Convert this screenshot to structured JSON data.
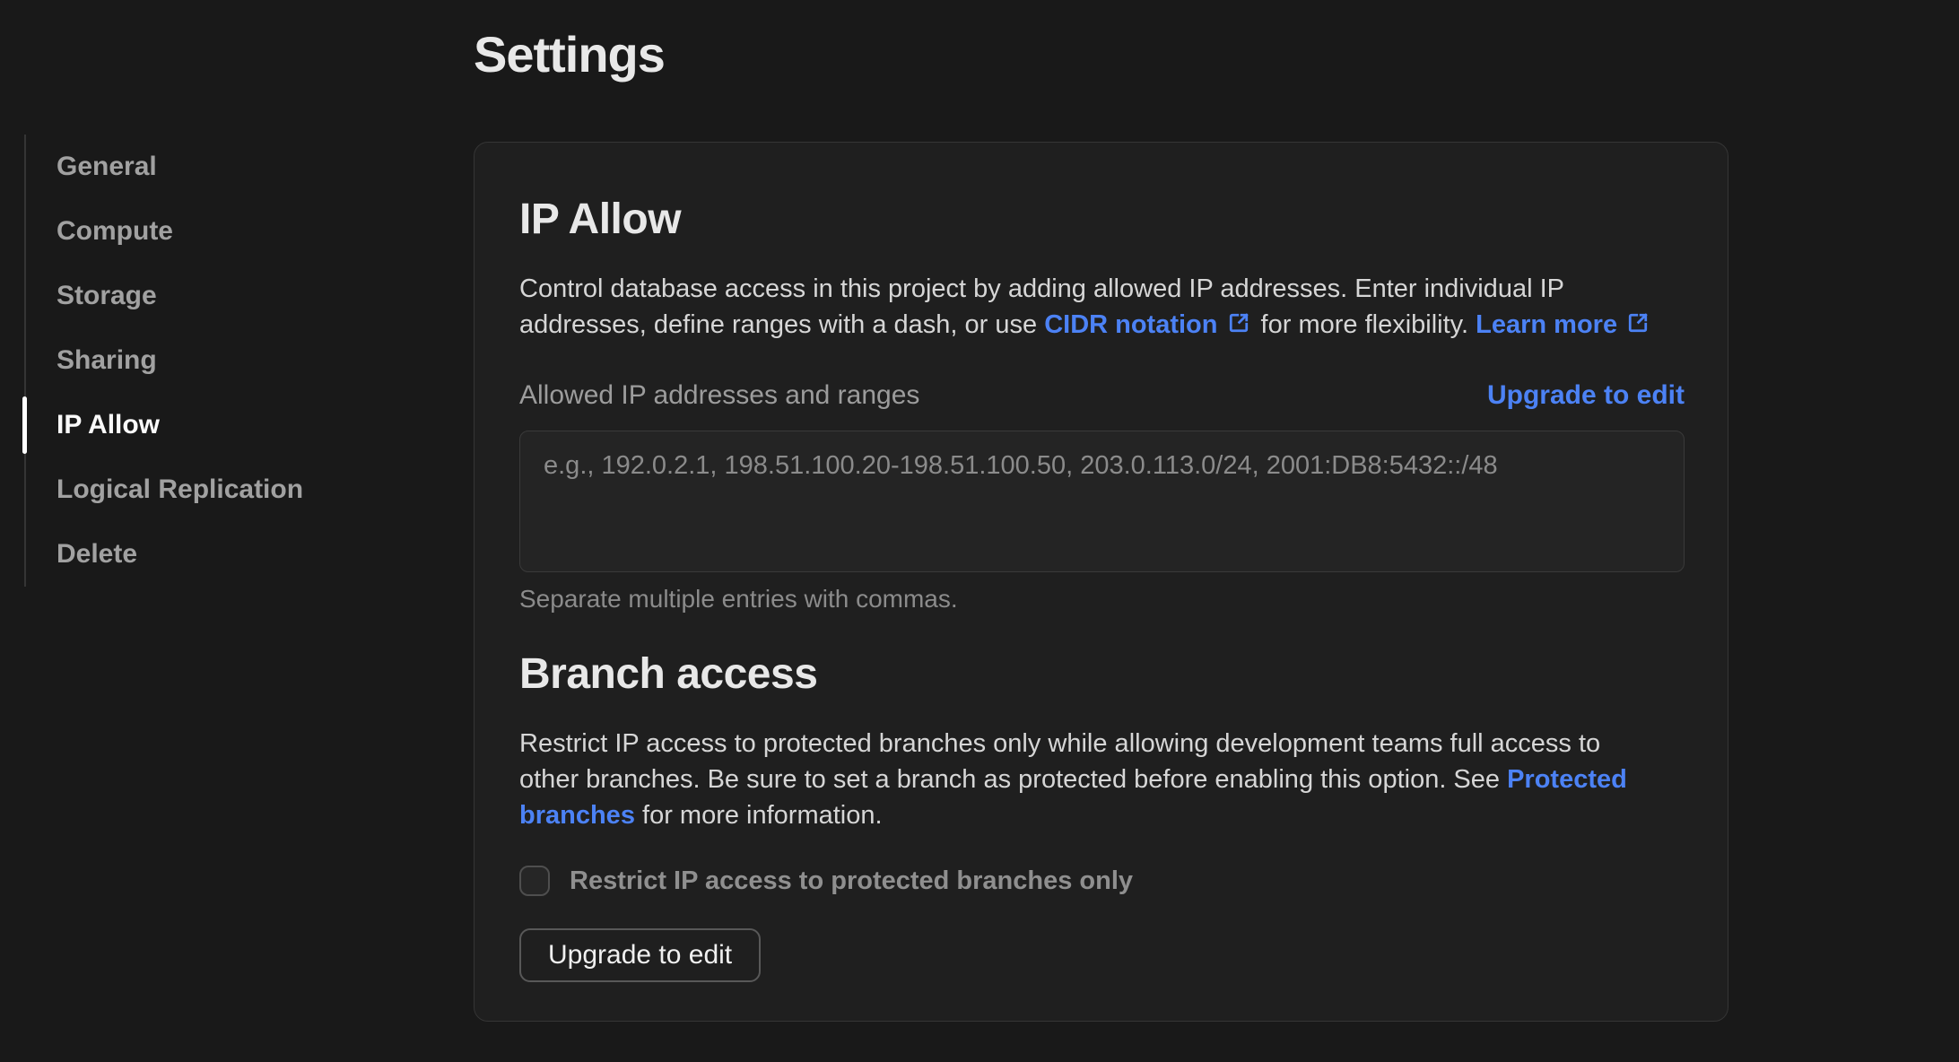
{
  "page": {
    "title": "Settings"
  },
  "sidebar": {
    "items": [
      {
        "label": "General",
        "active": false
      },
      {
        "label": "Compute",
        "active": false
      },
      {
        "label": "Storage",
        "active": false
      },
      {
        "label": "Sharing",
        "active": false
      },
      {
        "label": "IP Allow",
        "active": true
      },
      {
        "label": "Logical Replication",
        "active": false
      },
      {
        "label": "Delete",
        "active": false
      }
    ]
  },
  "ip_allow": {
    "heading": "IP Allow",
    "desc_line1": "Control database access in this project by adding allowed IP addresses. Enter individual IP",
    "desc_line2_pre": "addresses, define ranges with a dash, or use ",
    "cidr_link": "CIDR notation",
    "desc_line2_mid": " for more flexibility. ",
    "learn_more_link": "Learn more",
    "field_label": "Allowed IP addresses and ranges",
    "upgrade_link": "Upgrade to edit",
    "textarea_value": "",
    "textarea_placeholder": "e.g., 192.0.2.1, 198.51.100.20-198.51.100.50, 203.0.113.0/24, 2001:DB8:5432::/48",
    "helper": "Separate multiple entries with commas."
  },
  "branch_access": {
    "heading": "Branch access",
    "desc_line1": "Restrict IP access to protected branches only while allowing development teams full access to",
    "desc_line2_pre": "other branches. Be sure to set a branch as protected before enabling this option. See ",
    "protected_link_part1": "Protected",
    "protected_link_part2": "branches",
    "desc_line3_post": " for more information.",
    "checkbox_label": "Restrict IP access to protected branches only",
    "checkbox_checked": false,
    "button_label": "Upgrade to edit"
  },
  "colors": {
    "accent_blue": "#4c82f5",
    "page_bg": "#191919",
    "card_bg": "#1f1f1f"
  }
}
